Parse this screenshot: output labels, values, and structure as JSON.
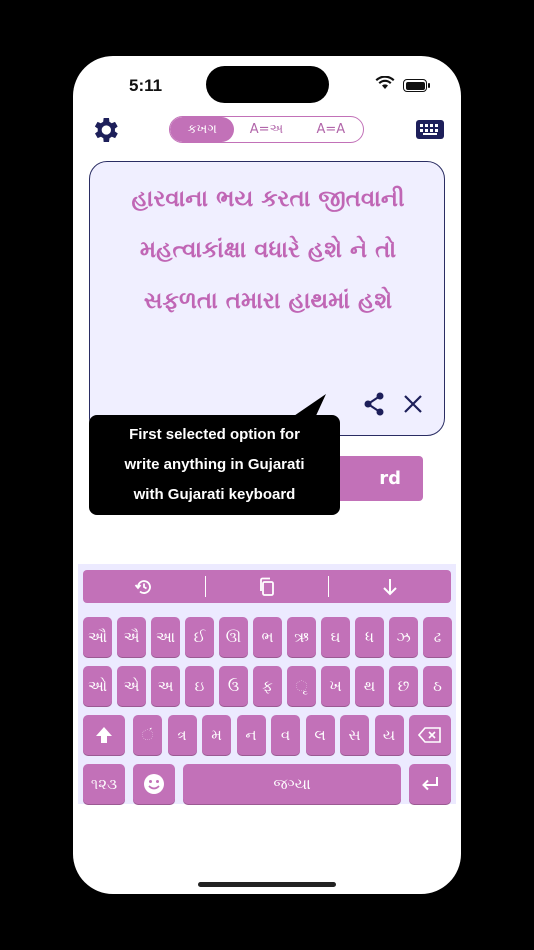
{
  "status": {
    "time": "5:11"
  },
  "toggle": {
    "options": [
      "કખગ",
      "A=અ",
      "A=A"
    ],
    "selected": "કખગ"
  },
  "editor": {
    "lines": [
      "હારવાના ભય કરતા જીતવાની",
      "મહત્વાકાંક્ષા વધારે હશે ને તો",
      "સફળતા તમારા હાથમાં હશે"
    ]
  },
  "background_button": {
    "label": "rd"
  },
  "tooltip": {
    "lines": [
      "First selected option for",
      "write anything in Gujarati",
      "with Gujarati keyboard"
    ]
  },
  "keyboard": {
    "row1": [
      "ઔ",
      "ઐ",
      "આ",
      "ઈ",
      "ઊ",
      "ભ",
      "ઋ",
      "ઘ",
      "ધ",
      "ઝ",
      "ઢ"
    ],
    "row2": [
      "ઓ",
      "એ",
      "અ",
      "ઇ",
      "ઉ",
      "ફ",
      "ૃ",
      "ખ",
      "થ",
      "છ",
      "ઠ"
    ],
    "row3": [
      "ં",
      "ત્ર",
      "મ",
      "ન",
      "વ",
      "લ",
      "સ",
      "ય"
    ],
    "numbers_label": "૧૨૩",
    "space_label": "જગ્યા"
  },
  "colors": {
    "accent": "#c271b8",
    "text_purple": "#c066b5",
    "navy": "#1d1f5a",
    "card_bg": "#f0efff"
  },
  "icons": [
    "gear-icon",
    "keyboard-icon",
    "share-icon",
    "close-icon",
    "history-icon",
    "copy-icon",
    "arrow-down-icon",
    "shift-icon",
    "backspace-icon",
    "emoji-icon",
    "return-icon"
  ]
}
